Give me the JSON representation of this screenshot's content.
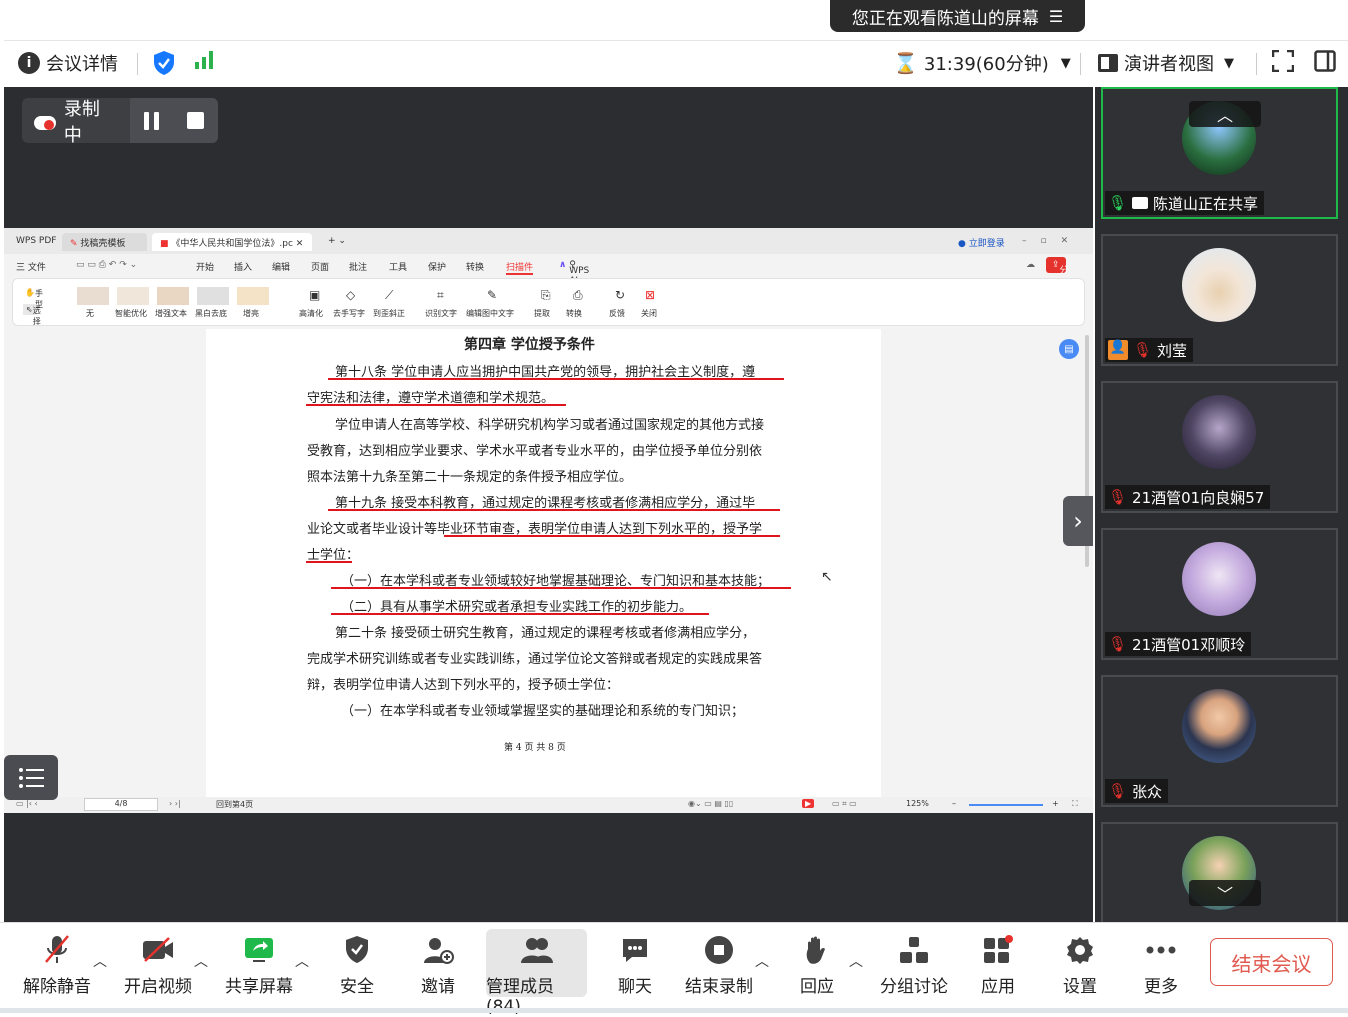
{
  "banner": {
    "text": "您正在观看陈道山的屏幕"
  },
  "topbar": {
    "meeting_info": "会议详情",
    "timer": "31:39(60分钟)",
    "view_mode": "演讲者视图"
  },
  "recording": {
    "label": "录制中"
  },
  "wps": {
    "tab_pdf": "WPS PDF",
    "tab_template": "找稿壳模板",
    "tab_doc": "《中华人民共和国学位法》.pc",
    "login": "立即登录",
    "share": "分享",
    "menu": [
      "三 文件",
      "开始",
      "插入",
      "编辑",
      "页面",
      "批注",
      "工具",
      "保护",
      "转换",
      "扫描件",
      "WPS AI"
    ],
    "ribbon": [
      "手型",
      "选择",
      "无",
      "智能优化",
      "增强文本",
      "黑白去底",
      "增亮",
      "高清化",
      "去手写字",
      "到歪斜正",
      "识别文字",
      "编辑图中文字",
      "提取",
      "转换",
      "反馈",
      "关闭"
    ],
    "status_page": "4/8",
    "status_back": "回到第4页",
    "zoom": "125%"
  },
  "document": {
    "chapter_title": "第四章   学位授予条件",
    "lines": [
      "第十八条   学位申请人应当拥护中国共产党的领导，拥护社会主义制度，遵",
      "守宪法和法律，遵守学术道德和学术规范。",
      "学位申请人在高等学校、科学研究机构学习或者通过国家规定的其他方式接",
      "受教育，达到相应学业要求、学术水平或者专业水平的，由学位授予单位分别依",
      "照本法第十九条至第二十一条规定的条件授予相应学位。",
      "第十九条   接受本科教育，通过规定的课程考核或者修满相应学分，通过毕",
      "业论文或者毕业设计等毕业环节审查，表明学位申请人达到下列水平的，授予学",
      "士学位：",
      "（一）在本学科或者专业领域较好地掌握基础理论、专门知识和基本技能；",
      "（二）具有从事学术研究或者承担专业实践工作的初步能力。",
      "第二十条   接受硕士研究生教育，通过规定的课程考核或者修满相应学分，",
      "完成学术研究训练或者专业实践训练，通过学位论文答辩或者规定的实践成果答",
      "辩，表明学位申请人达到下列水平的，授予硕士学位：",
      "（一）在本学科或者专业领域掌握坚实的基础理论和系统的专门知识；"
    ],
    "footer": "第 4 页 共 8 页"
  },
  "participants": [
    {
      "name": "陈道山正在共享"
    },
    {
      "name": "刘莹"
    },
    {
      "name": "21酒管01向良娴57"
    },
    {
      "name": "21酒管01邓顺玲"
    },
    {
      "name": "张众"
    }
  ],
  "bottombar": {
    "unmute": "解除静音",
    "video": "开启视频",
    "share": "共享屏幕",
    "security": "安全",
    "invite": "邀请",
    "members": "管理成员(84)",
    "chat": "聊天",
    "stop_record": "结束录制",
    "react": "回应",
    "breakout": "分组讨论",
    "apps": "应用",
    "settings": "设置",
    "more": "更多",
    "end": "结束会议"
  },
  "colors": {
    "accent_green": "#1fb84a",
    "end_red": "#e05a4f",
    "underline_red": "#e0151b"
  }
}
